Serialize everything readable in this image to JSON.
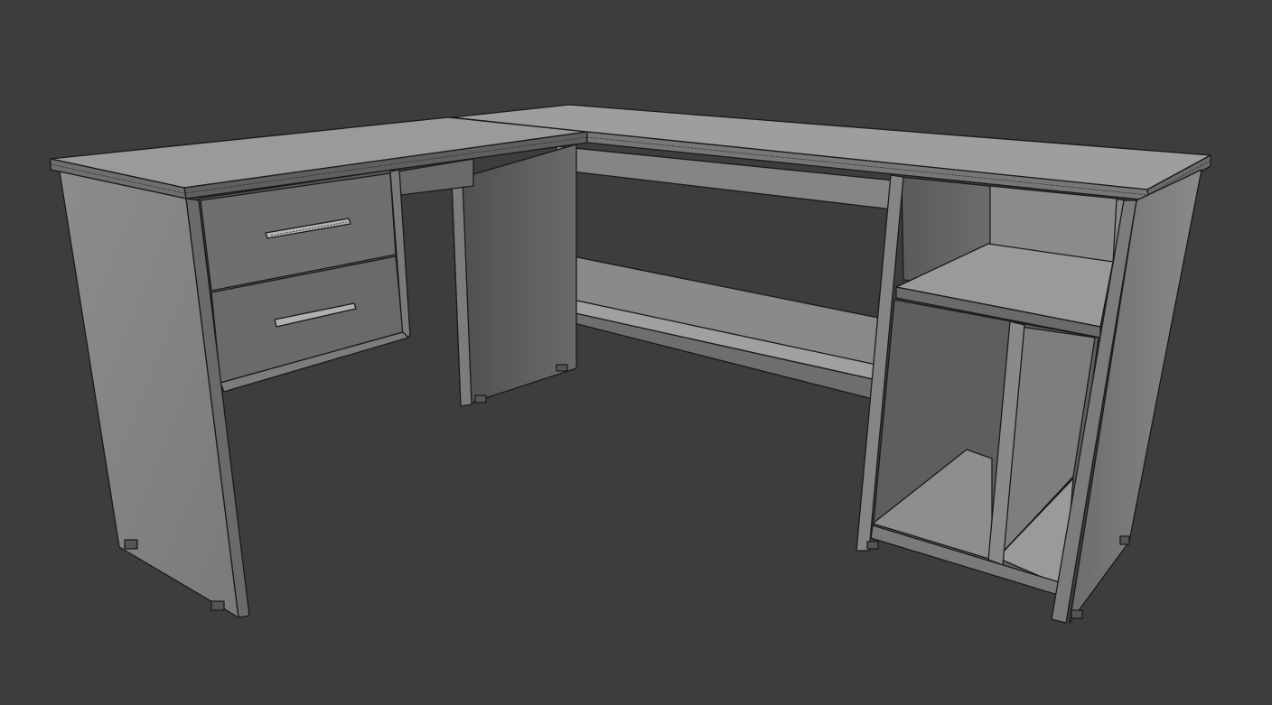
{
  "viewport": {
    "background_color": "#3d3d3d",
    "shading": "solid-gray-with-wireframe-edges"
  },
  "scene": {
    "object": "l-shaped-desk",
    "parts": [
      "left-desktop",
      "right-desktop",
      "drawer-top",
      "drawer-bottom",
      "drawer-handle-top",
      "drawer-handle-bottom",
      "side-panels",
      "modesty-panel",
      "footrest-shelf",
      "cabinet-shelf",
      "cabinet-divider",
      "cabinet-floor",
      "feet"
    ]
  },
  "colors": {
    "top": "#9c9c9c",
    "side_light": "#8e8e8e",
    "side_mid": "#7a7a7a",
    "side_dark": "#5c5c5c",
    "drawer_front": "#6e6e6e",
    "edge": "#1a1a1a"
  }
}
